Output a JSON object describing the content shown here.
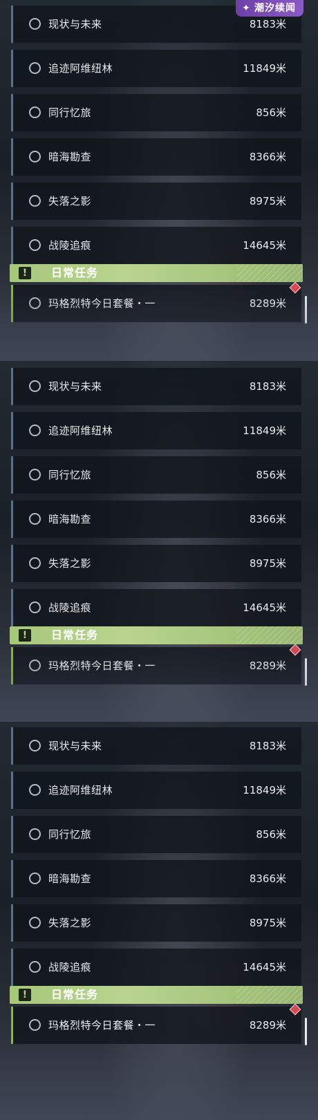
{
  "watermark": {
    "text": "潮汐续闻",
    "icon": "star-logo-icon"
  },
  "quest_panels": [
    {
      "quests": [
        {
          "name": "现状与未来",
          "distance": "8183米"
        },
        {
          "name": "追迹阿维纽林",
          "distance": "11849米"
        },
        {
          "name": "同行忆旅",
          "distance": "856米"
        },
        {
          "name": "暗海勘查",
          "distance": "8366米"
        },
        {
          "name": "失落之影",
          "distance": "8975米"
        },
        {
          "name": "战陵追痕",
          "distance": "14645米"
        }
      ],
      "section_header": {
        "title": "日常任务",
        "icon": "exclamation-icon"
      },
      "daily_quests": [
        {
          "name": "玛格烈特今日套餐・一",
          "distance": "8289米"
        }
      ]
    },
    {
      "quests": [
        {
          "name": "现状与未来",
          "distance": "8183米"
        },
        {
          "name": "追迹阿维纽林",
          "distance": "11849米"
        },
        {
          "name": "同行忆旅",
          "distance": "856米"
        },
        {
          "name": "暗海勘查",
          "distance": "8366米"
        },
        {
          "name": "失落之影",
          "distance": "8975米"
        },
        {
          "name": "战陵追痕",
          "distance": "14645米"
        }
      ],
      "section_header": {
        "title": "日常任务",
        "icon": "exclamation-icon"
      },
      "daily_quests": [
        {
          "name": "玛格烈特今日套餐・一",
          "distance": "8289米"
        }
      ]
    },
    {
      "quests": [
        {
          "name": "现状与未来",
          "distance": "8183米"
        },
        {
          "name": "追迹阿维纽林",
          "distance": "11849米"
        },
        {
          "name": "同行忆旅",
          "distance": "856米"
        },
        {
          "name": "暗海勘查",
          "distance": "8366米"
        },
        {
          "name": "失落之影",
          "distance": "8975米"
        },
        {
          "name": "战陵追痕",
          "distance": "14645米"
        }
      ],
      "section_header": {
        "title": "日常任务",
        "icon": "exclamation-icon"
      },
      "daily_quests": [
        {
          "name": "玛格烈特今日套餐・一",
          "distance": "8289米"
        }
      ]
    }
  ],
  "colors": {
    "row_bg": "#10151b",
    "row_accent": "#5d7186",
    "daily_accent": "#8fae5f",
    "header_bg": "#b9d48f",
    "alert_marker": "#d64a55",
    "watermark_bg": "#7a4bb6"
  }
}
